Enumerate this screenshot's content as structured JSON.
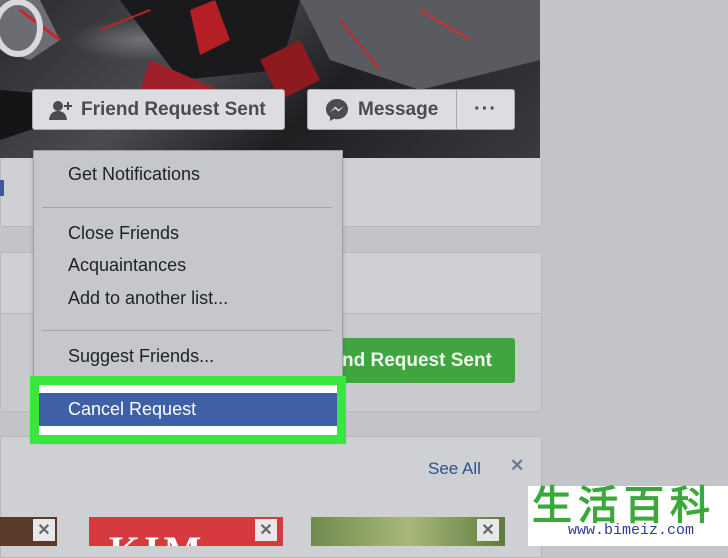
{
  "profile": {
    "friend_request_button": "Friend Request Sent",
    "message_button": "Message",
    "more_button": "···"
  },
  "dropdown": {
    "items": [
      "Get Notifications",
      "Close Friends",
      "Acquaintances",
      "Add to another list...",
      "Suggest Friends..."
    ],
    "cancel_request": "Cancel Request"
  },
  "background": {
    "green_button": "nd Request Sent",
    "see_all": "See All",
    "close_glyph": "✕",
    "thumb_text": "KIM"
  },
  "watermark": {
    "chars": "生活百科",
    "url": "www.bimeiz.com"
  },
  "colors": {
    "highlight": "#39e63d",
    "cancel_bg": "#3f5fa6",
    "fb_green": "#41a53f"
  }
}
